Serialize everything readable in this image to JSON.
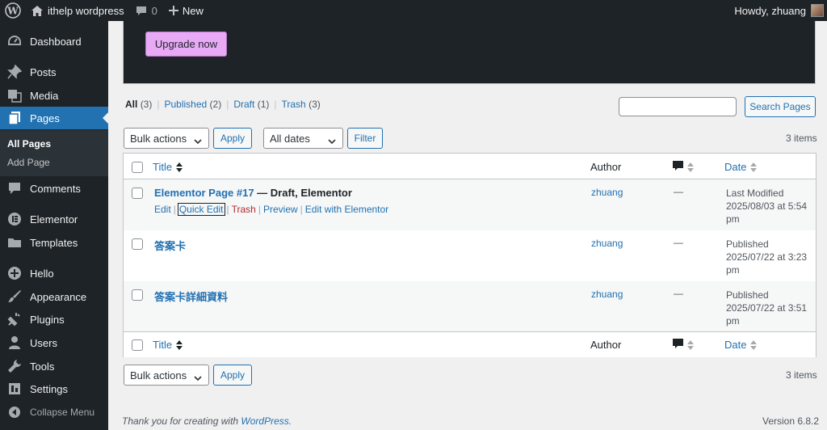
{
  "adminbar": {
    "site_name": "ithelp wordpress",
    "comments_count": "0",
    "new_label": "New",
    "howdy": "Howdy, zhuang"
  },
  "sidebar": {
    "items": [
      {
        "label": "Dashboard",
        "icon": "dashboard-icon"
      },
      {
        "label": "Posts",
        "icon": "pin-icon"
      },
      {
        "label": "Media",
        "icon": "media-icon"
      },
      {
        "label": "Pages",
        "icon": "pages-icon"
      },
      {
        "label": "Comments",
        "icon": "comment-icon"
      },
      {
        "label": "Elementor",
        "icon": "elementor-icon"
      },
      {
        "label": "Templates",
        "icon": "folder-icon"
      },
      {
        "label": "Hello",
        "icon": "plus-circle-icon"
      },
      {
        "label": "Appearance",
        "icon": "brush-icon"
      },
      {
        "label": "Plugins",
        "icon": "plug-icon"
      },
      {
        "label": "Users",
        "icon": "user-icon"
      },
      {
        "label": "Tools",
        "icon": "wrench-icon"
      },
      {
        "label": "Settings",
        "icon": "settings-icon"
      }
    ],
    "submenu": [
      "All Pages",
      "Add Page"
    ],
    "collapse_label": "Collapse Menu"
  },
  "banner": {
    "upgrade_label": "Upgrade now"
  },
  "filters": {
    "all": "All",
    "all_count": "(3)",
    "published": "Published",
    "published_count": "(2)",
    "draft": "Draft",
    "draft_count": "(1)",
    "trash": "Trash",
    "trash_count": "(3)"
  },
  "search": {
    "button_label": "Search Pages",
    "value": ""
  },
  "toolbar": {
    "bulk_actions": "Bulk actions",
    "apply": "Apply",
    "all_dates": "All dates",
    "filter": "Filter",
    "items_count": "3 items"
  },
  "table": {
    "columns": {
      "title": "Title",
      "author": "Author",
      "date": "Date"
    },
    "rows": [
      {
        "title": "Elementor Page #17",
        "state": " — Draft, Elementor",
        "author": "zhuang",
        "comments": "—",
        "date_status": "Last Modified",
        "date_line1": "2025/08/03 at 5:54",
        "date_line2": "pm"
      },
      {
        "title": "答案卡",
        "state": "",
        "author": "zhuang",
        "comments": "—",
        "date_status": "Published",
        "date_line1": "2025/07/22 at 3:23",
        "date_line2": "pm"
      },
      {
        "title": "答案卡詳細資料",
        "state": "",
        "author": "zhuang",
        "comments": "—",
        "date_status": "Published",
        "date_line1": "2025/07/22 at 3:51",
        "date_line2": "pm"
      }
    ],
    "row_actions": {
      "edit": "Edit",
      "quick_edit": "Quick Edit",
      "trash": "Trash",
      "preview": "Preview",
      "edit_elementor": "Edit with Elementor",
      "sep": "|"
    }
  },
  "footer": {
    "thanks_prefix": "Thank you for creating with ",
    "thanks_link": "WordPress",
    "thanks_suffix": ".",
    "version": "Version 6.8.2"
  },
  "colors": {
    "accent": "#2271b1",
    "sidebar_bg": "#1d2327",
    "upgrade_bg": "#e8a9f5",
    "trash": "#b32d2e"
  }
}
